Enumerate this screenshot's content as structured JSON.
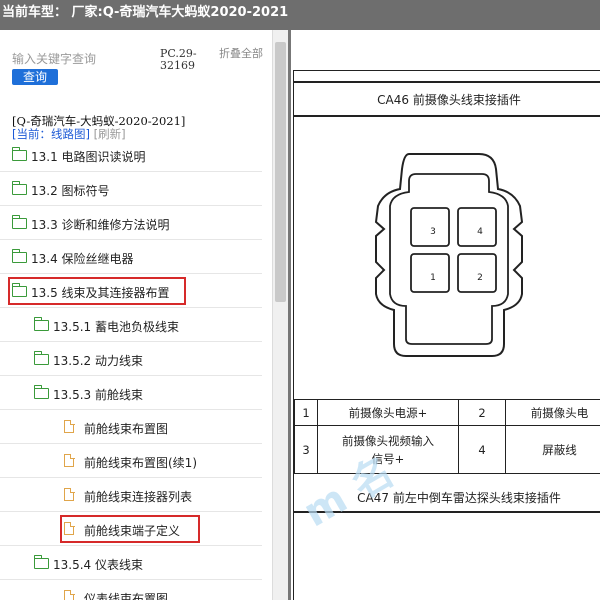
{
  "title_bar": {
    "text": "当前车型： 厂家:Q-奇瑞汽车大蚂蚁2020-2021"
  },
  "search": {
    "placeholder": "输入关键字查询",
    "button_label": "查询",
    "pc_code": "PC.29-32169",
    "collapse_all": "折叠全部"
  },
  "model_path": "[Q-奇瑞汽车-大蚂蚁-2020-2021]",
  "current": {
    "label": "[当前：线路图]",
    "refresh": "[刷新]"
  },
  "tree": [
    {
      "label": "13.1 电路图识读说明",
      "level": 0,
      "type": "folder"
    },
    {
      "label": "13.2 图标符号",
      "level": 0,
      "type": "folder"
    },
    {
      "label": "13.3 诊断和维修方法说明",
      "level": 0,
      "type": "folder"
    },
    {
      "label": "13.4 保险丝继电器",
      "level": 0,
      "type": "folder"
    },
    {
      "label": "13.5 线束及其连接器布置",
      "level": 0,
      "type": "folder-open",
      "highlighted": true
    },
    {
      "label": "13.5.1 蓄电池负极线束",
      "level": 1,
      "type": "folder"
    },
    {
      "label": "13.5.2 动力线束",
      "level": 1,
      "type": "folder"
    },
    {
      "label": "13.5.3 前舱线束",
      "level": 1,
      "type": "folder-open"
    },
    {
      "label": "前舱线束布置图",
      "level": 2,
      "type": "doc"
    },
    {
      "label": "前舱线束布置图(续1)",
      "level": 2,
      "type": "doc"
    },
    {
      "label": "前舱线束连接器列表",
      "level": 2,
      "type": "doc"
    },
    {
      "label": "前舱线束端子定义",
      "level": 2,
      "type": "doc",
      "highlighted": true
    },
    {
      "label": "13.5.4 仪表线束",
      "level": 1,
      "type": "folder-open"
    },
    {
      "label": "仪表线束布置图",
      "level": 2,
      "type": "doc"
    }
  ],
  "document": {
    "ca46_title": "CA46 前摄像头线束接插件",
    "pins": [
      "3",
      "4",
      "1",
      "2"
    ],
    "table": [
      [
        "1",
        "前摄像头电源+",
        "2",
        "前摄像头电"
      ],
      [
        "3",
        "前摄像头视频输入信号+",
        "4",
        "屏蔽线"
      ]
    ],
    "ca47_title": "CA47 前左中倒车雷达探头线束接插件",
    "watermark": "m 名"
  },
  "colors": {
    "title_bar_bg": "#6e6e6e",
    "accent_blue": "#1e6fd9",
    "highlight_red": "#d62a2a",
    "folder_green": "#3a9a3a",
    "doc_orange": "#e0a54a"
  }
}
